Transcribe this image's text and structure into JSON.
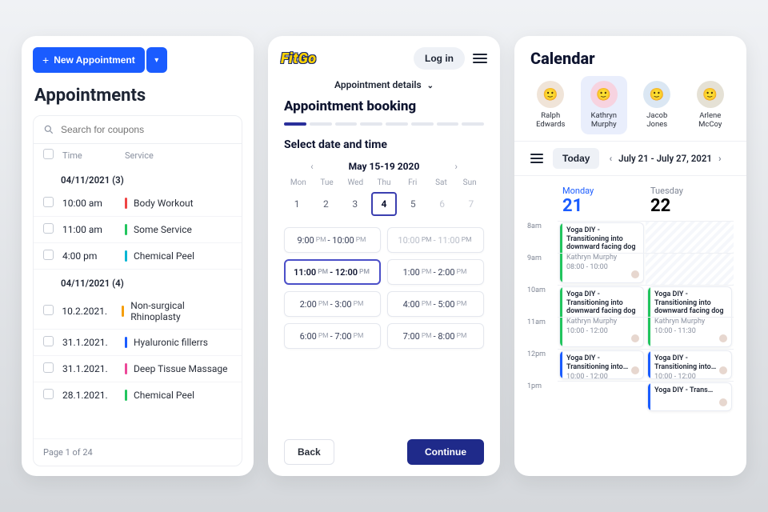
{
  "colors": {
    "blue": "#1a5cff",
    "indigo": "#1f2a8a",
    "green": "#22c55e",
    "teal": "#06b6d4",
    "orange": "#f59e0b",
    "pink": "#ec4899",
    "red": "#ef4444",
    "purple": "#8b5cf6"
  },
  "panel1": {
    "new_appointment_label": "New Appointment",
    "title": "Appointments",
    "search_placeholder": "Search for coupons",
    "headers": {
      "time": "Time",
      "service": "Service"
    },
    "groups": [
      {
        "label": "04/11/2021 (3)",
        "rows": [
          {
            "time": "10:00 am",
            "service": "Body Workout",
            "color": "red"
          },
          {
            "time": "11:00 am",
            "service": "Some Service",
            "color": "green"
          },
          {
            "time": "4:00 pm",
            "service": "Chemical Peel",
            "color": "teal"
          }
        ]
      },
      {
        "label": "04/11/2021 (4)",
        "rows": [
          {
            "time": "10.2.2021.",
            "service": "Non-surgical Rhinoplasty",
            "color": "orange"
          },
          {
            "time": "31.1.2021.",
            "service": "Hyaluronic fillerrs",
            "color": "blue"
          },
          {
            "time": "31.1.2021.",
            "service": "Deep Tissue Massage",
            "color": "pink"
          },
          {
            "time": "28.1.2021.",
            "service": "Chemical Peel",
            "color": "green"
          }
        ]
      }
    ],
    "footer": "Page 1 of 24"
  },
  "panel2": {
    "brand": "FitGo",
    "login_label": "Log in",
    "details_label": "Appointment details",
    "title": "Appointment booking",
    "subtitle": "Select date  and time",
    "progress_step": 1,
    "progress_total": 8,
    "date_range_label": "May 15-19 2020",
    "weekdays": [
      "Mon",
      "Tue",
      "Wed",
      "Thu",
      "Fri",
      "Sat",
      "Sun"
    ],
    "days": [
      {
        "n": "1",
        "dim": false
      },
      {
        "n": "2",
        "dim": false
      },
      {
        "n": "3",
        "dim": false
      },
      {
        "n": "4",
        "dim": false,
        "selected": true
      },
      {
        "n": "5",
        "dim": false
      },
      {
        "n": "6",
        "dim": true
      },
      {
        "n": "7",
        "dim": true
      }
    ],
    "slots": [
      {
        "from": "9:00",
        "fu": "PM",
        "to": "10:00",
        "tu": "PM",
        "dim": false
      },
      {
        "from": "10:00",
        "fu": "PM",
        "to": "11:00",
        "tu": "PM",
        "dim": true
      },
      {
        "from": "11:00",
        "fu": "PM",
        "to": "12:00",
        "tu": "PM",
        "dim": false,
        "selected": true
      },
      {
        "from": "1:00",
        "fu": "PM",
        "to": "2:00",
        "tu": "PM",
        "dim": false
      },
      {
        "from": "2:00",
        "fu": "PM",
        "to": "3:00",
        "tu": "PM",
        "dim": false
      },
      {
        "from": "4:00",
        "fu": "PM",
        "to": "5:00",
        "tu": "PM",
        "dim": false
      },
      {
        "from": "6:00",
        "fu": "PM",
        "to": "7:00",
        "tu": "PM",
        "dim": false
      },
      {
        "from": "7:00",
        "fu": "PM",
        "to": "8:00",
        "tu": "PM",
        "dim": false
      }
    ],
    "back_label": "Back",
    "continue_label": "Continue"
  },
  "panel3": {
    "title": "Calendar",
    "people": [
      {
        "name": "Ralph Edwards",
        "bg": "#f0e4d8"
      },
      {
        "name": "Kathryn Murphy",
        "bg": "#f7d3e0",
        "selected": true
      },
      {
        "name": "Jacob Jones",
        "bg": "#dbe7f3"
      },
      {
        "name": "Arlene McCoy",
        "bg": "#e5e1d5"
      }
    ],
    "today_label": "Today",
    "range_label": "July 21 - July 27, 2021",
    "day_cols": [
      {
        "label": "Monday",
        "num": "21",
        "isMon": true
      },
      {
        "label": "Tuesday",
        "num": "22",
        "isMon": false
      }
    ],
    "hours": [
      "8am",
      "9am",
      "10am",
      "11am",
      "12pm",
      "1pm"
    ],
    "events": [
      {
        "col": 1,
        "row": 0,
        "span": 2,
        "color": "green",
        "title": "Yoga DIY - Transitioning into downward facing dog",
        "sub": "Kathryn Murphy",
        "time": "08:00 - 10:00"
      },
      {
        "col": 1,
        "row": 2,
        "span": 2,
        "color": "green",
        "title": "Yoga DIY - Transitioning into downward facing dog",
        "sub": "Kathryn Murphy",
        "time": "10:00 - 12:00"
      },
      {
        "col": 2,
        "row": 2,
        "span": 2,
        "color": "green",
        "title": "Yoga DIY - Transitioning into downward facing dog",
        "sub": "Kathryn Murphy",
        "time": "10:00 - 11:30"
      },
      {
        "col": 1,
        "row": 4,
        "span": 1,
        "color": "blue",
        "title": "Yoga DIY - Transitioning into…",
        "sub": "",
        "time": "10:00 - 12:00"
      },
      {
        "col": 2,
        "row": 4,
        "span": 1,
        "color": "blue",
        "title": "Yoga DIY - Transitioning into…",
        "sub": "",
        "time": "10:00 - 12:00"
      },
      {
        "col": 2,
        "row": 5,
        "span": 1,
        "color": "blue",
        "title": "Yoga DIY - Trans…",
        "sub": "",
        "time": ""
      }
    ]
  }
}
